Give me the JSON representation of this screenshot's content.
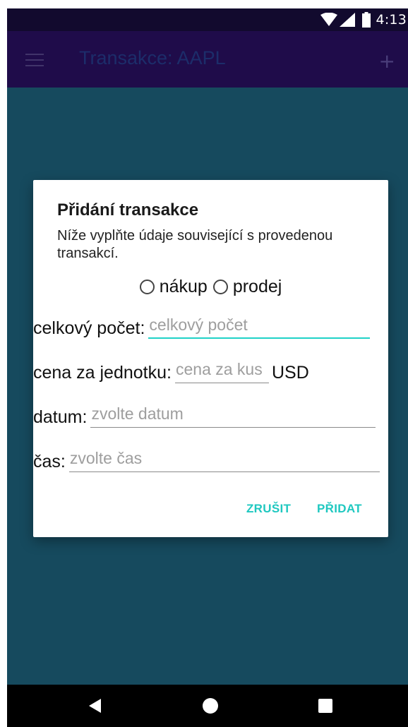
{
  "status_bar": {
    "time": "4:13",
    "icons": [
      "wifi-icon",
      "signal-icon",
      "battery-icon"
    ]
  },
  "app_bar": {
    "title": "Transakce: AAPL",
    "menu_icon": "hamburger-menu-icon",
    "add_label": "+"
  },
  "dialog": {
    "title": "Přidání transakce",
    "description": "Níže vyplňte údaje související s provedenou transakcí.",
    "radio_options": {
      "buy": "nákup",
      "sell": "prodej"
    },
    "fields": {
      "count": {
        "label": "celkový počet:",
        "placeholder": "celkový počet"
      },
      "price": {
        "label": "cena za jednotku:",
        "placeholder": "cena za kus",
        "suffix": "USD"
      },
      "date": {
        "label": "datum:",
        "placeholder": "zvolte datum"
      },
      "time": {
        "label": "čas:",
        "placeholder": "zvolte čas"
      }
    },
    "buttons": {
      "cancel": "ZRUŠIT",
      "add": "PŘIDAT"
    }
  },
  "colors": {
    "status_bar": "#120a2e",
    "app_bar": "#1f0c4a",
    "background": "#164a5e",
    "accent": "#1fc8c0",
    "nav_bar": "#000000"
  }
}
